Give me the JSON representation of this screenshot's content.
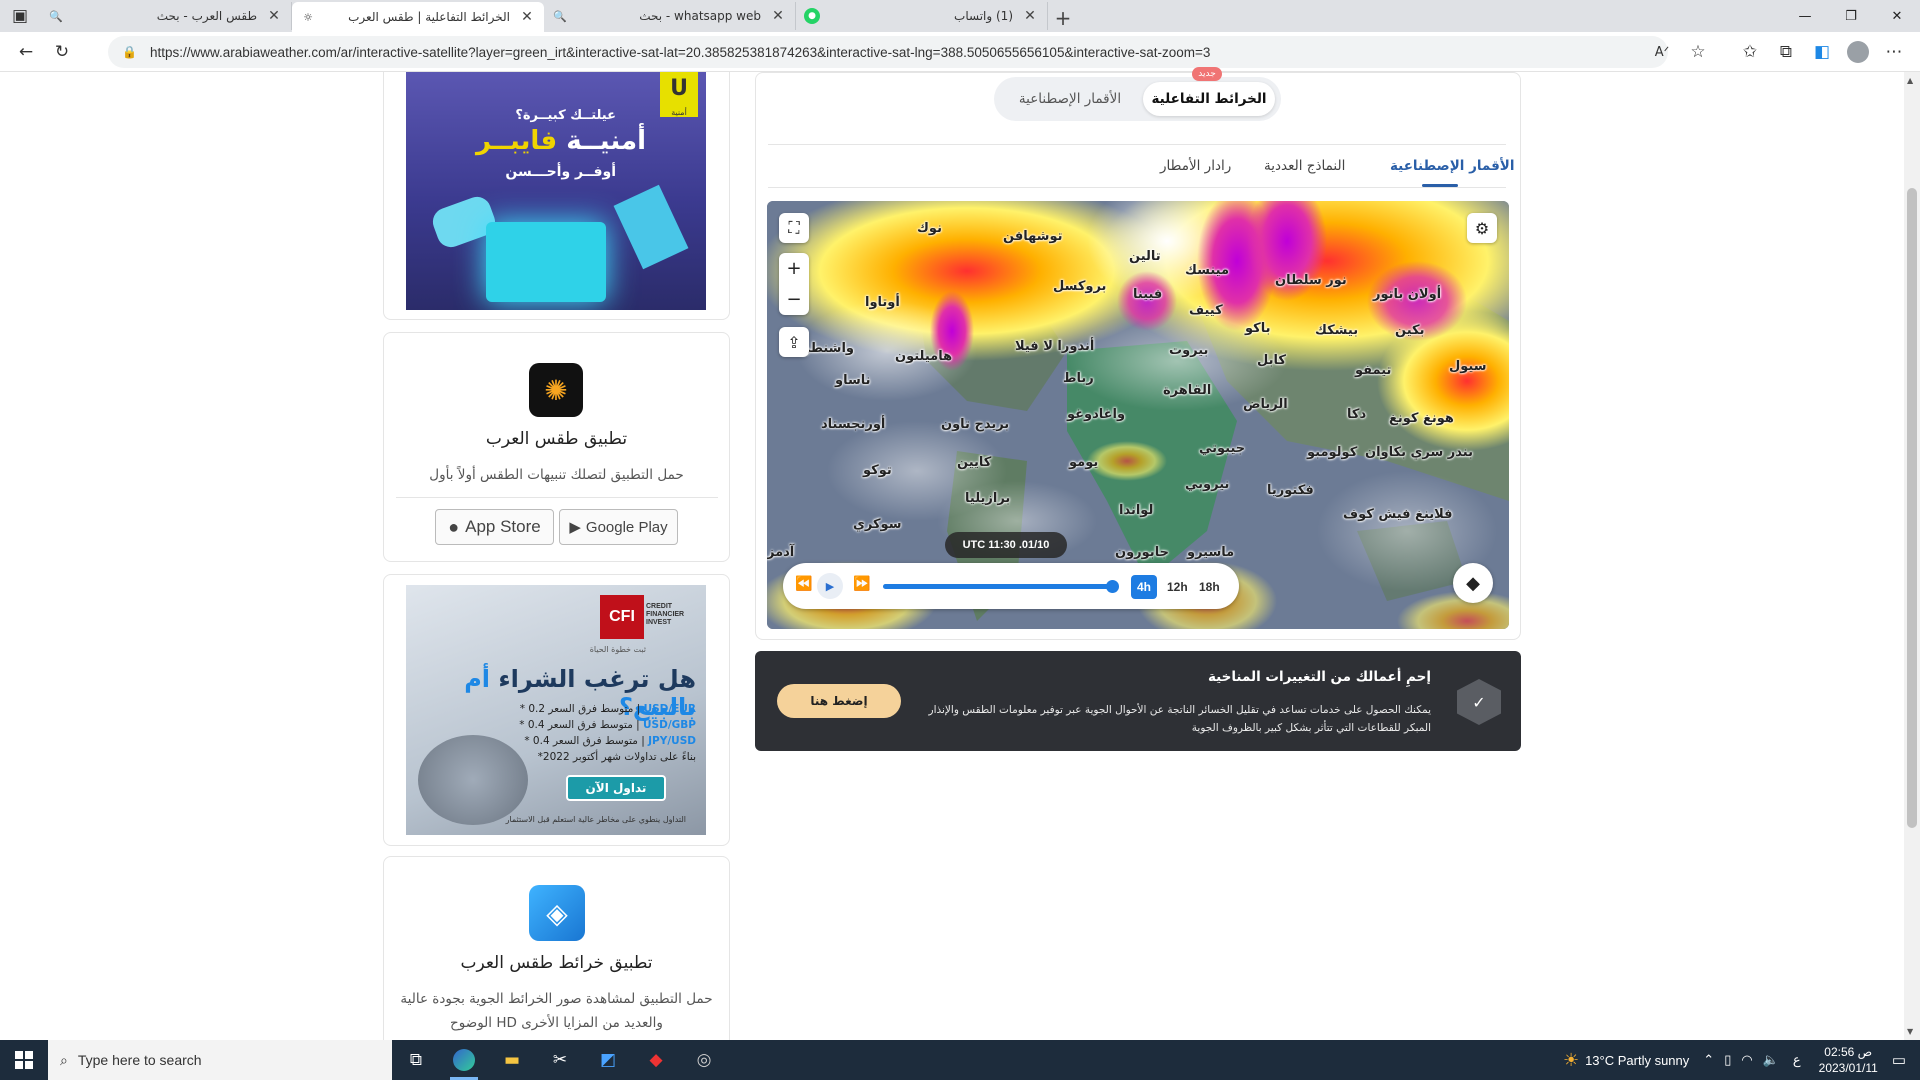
{
  "browser": {
    "tabs": [
      {
        "title": "طقس العرب - بحث",
        "icon": "search-icon",
        "active": false
      },
      {
        "title": "الخرائط التفاعلية | طقس العرب",
        "icon": "arabiaweather-icon",
        "active": true
      },
      {
        "title": "whatsapp web - بحث",
        "icon": "search-icon",
        "active": false
      },
      {
        "title": "(1) واتساب",
        "icon": "whatsapp-icon",
        "active": false
      }
    ],
    "url": "https://www.arabiaweather.com/ar/interactive-satellite?layer=green_irt&interactive-sat-lat=20.385825381874263&interactive-sat-lng=388.5050655656105&interactive-sat-zoom=3"
  },
  "sidebar": {
    "ad1": {
      "logo": "U",
      "logo_sub": "أمنية",
      "line1": "عيلتــك كبيــرة؟",
      "line2_a": "أمنيــة ",
      "line2_b": "فايبــر",
      "line3": "أوفــر وأحـــسن"
    },
    "app1": {
      "title": "تطبيق طقس العرب",
      "desc": "حمل التطبيق لتصلك تنبيهات الطقس أولاً بأول",
      "appstore": "App Store",
      "googleplay": "Google Play"
    },
    "ad2": {
      "logo": "CFI",
      "logo_name": "CREDIT FINANCIER INVEST",
      "tagline": "ثبت خطوة الحياة",
      "head_a": "هل ترغب الشراء ",
      "head_b": "أم بالبيع؟",
      "lines": [
        {
          "pair": "USD/EUR",
          "text": " | متوسط فرق السعر 0.2 *"
        },
        {
          "pair": "USD/GBP",
          "text": " | متوسط فرق السعر 0.4 *"
        },
        {
          "pair": "JPY/USD",
          "text": " | متوسط فرق السعر 0.4 *"
        },
        {
          "pair": "",
          "text": "بناءً على تداولات شهر أكتوبر 2022*"
        }
      ],
      "cta": "تداول الآن",
      "disclaimer": "التداول ينطوي على مخاطر عالية استعلم قبل الاستثمار"
    },
    "app2": {
      "title": "تطبيق خرائط طقس العرب",
      "desc_1": "حمل التطبيق لمشاهدة صور الخرائط الجوية بجودة عالية",
      "desc_2": "الوضوح HD والعديد من المزايا الأخرى"
    }
  },
  "main": {
    "toggle": {
      "active": "الخرائط التفاعلية",
      "inactive": "الأقمار الإصطناعية",
      "badge": "جديد"
    },
    "subtabs": [
      "الأقمار الإصطناعية",
      "النماذج العددية",
      "رادار الأمطار"
    ],
    "map": {
      "labels": [
        {
          "t": "نوك"
        },
        {
          "t": "توشهافن"
        },
        {
          "t": "تالين"
        },
        {
          "t": "مينسك"
        },
        {
          "t": "نور سلطان"
        },
        {
          "t": "أولان باتور"
        },
        {
          "t": "أوتاوا"
        },
        {
          "t": "بروكسل"
        },
        {
          "t": "فيينا"
        },
        {
          "t": "كييف"
        },
        {
          "t": "باكو"
        },
        {
          "t": "بيشكك"
        },
        {
          "t": "بكين"
        },
        {
          "t": "واشنطن"
        },
        {
          "t": "هاميلتون"
        },
        {
          "t": "أندورا لا فيلا"
        },
        {
          "t": "بيروت"
        },
        {
          "t": "كابل"
        },
        {
          "t": "تيمفو"
        },
        {
          "t": "سيول"
        },
        {
          "t": "ناساو"
        },
        {
          "t": "رباط"
        },
        {
          "t": "القاهرة"
        },
        {
          "t": "الرياض"
        },
        {
          "t": "دكا"
        },
        {
          "t": "هونغ كونغ"
        },
        {
          "t": "أورنجستاد"
        },
        {
          "t": "بريدج تاون"
        },
        {
          "t": "واغادوغو"
        },
        {
          "t": "جيبوتي"
        },
        {
          "t": "كولومبو"
        },
        {
          "t": "بندر سري بكاوان"
        },
        {
          "t": "توكو"
        },
        {
          "t": "كايين"
        },
        {
          "t": "يومو"
        },
        {
          "t": "نيروبي"
        },
        {
          "t": "فكتوريا"
        },
        {
          "t": "برازيليا"
        },
        {
          "t": "لواندا"
        },
        {
          "t": "فلاينغ فيش كوف"
        },
        {
          "t": "سوكري"
        },
        {
          "t": "آدمز"
        },
        {
          "t": "جابورون"
        },
        {
          "t": "ماسيرو"
        }
      ],
      "timestamp": "UTC 11:30 .01/10",
      "intervals": [
        "4h",
        "12h",
        "18h"
      ],
      "active_interval": "4h",
      "progress": 0.98
    }
  },
  "banner": {
    "title": "إحمِ أعمالك من التغييرات المناخية",
    "text": "يمكنك الحصول على خدمات تساعد في تقليل الخسائر الناتجة عن الأحوال الجوية عبر توفير معلومات الطقس والإنذار المبكر للقطاعات التي تتأثر بشكل كبير بالظروف الجوية",
    "button": "إضغط هنا"
  },
  "taskbar": {
    "search_placeholder": "Type here to search",
    "weather": "13°C  Partly sunny",
    "lang": "ع",
    "time": "02:56 ص",
    "date": "2023/01/11"
  }
}
